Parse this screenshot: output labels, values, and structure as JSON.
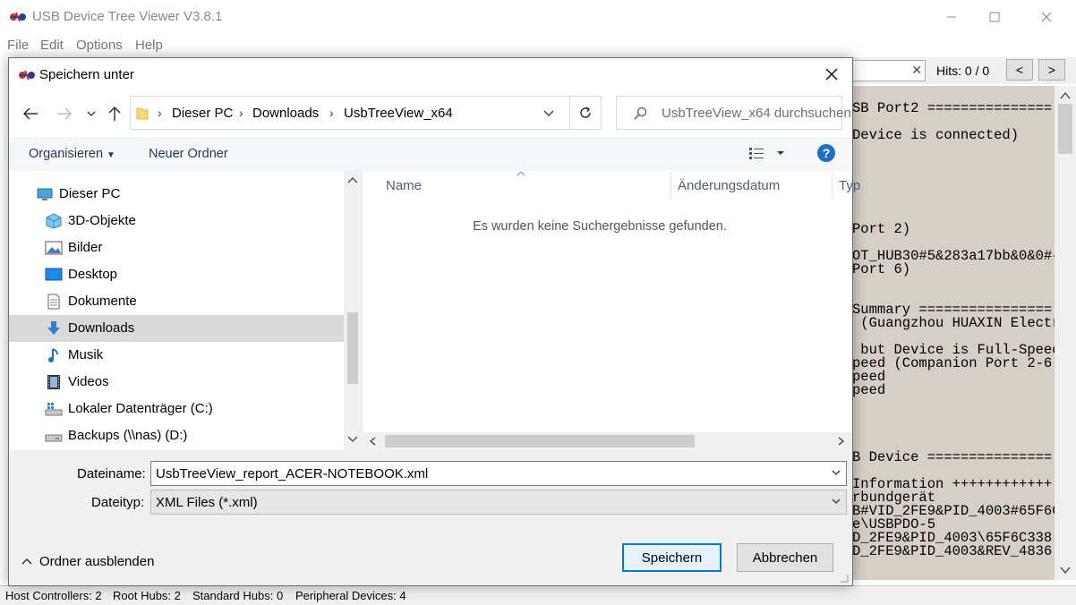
{
  "main_window": {
    "title": "USB Device Tree Viewer V3.8.1",
    "menu": [
      "File",
      "Edit",
      "Options",
      "Help"
    ],
    "hits_label": "Hits: 0 / 0",
    "hits_clear": "✕",
    "prev_btn": "<",
    "next_btn": ">",
    "text_lines": [
      "SB Port2 ===============",
      "Device is connected)",
      "Port 2)",
      "OT_HUB30#5&283a17bb&0&0#{",
      "Port 6)",
      "Summary ================",
      " (Guangzhou HUAXIN Electr",
      " but Device is Full-Speed",
      "peed (Companion Port 2-6",
      "peed",
      "peed",
      "B Device ===============",
      "Information ++++++++++++",
      "rbundgerät",
      "B#VID_2FE9&PID_4003#65F6C",
      "e\\USBPDO-5",
      "D_2FE9&PID_4003\\65F6C338",
      "D_2FE9&PID_4003&REV_4836"
    ],
    "status": {
      "host_controllers": "Host Controllers: 2",
      "root_hubs": "Root Hubs: 2",
      "standard_hubs": "Standard Hubs: 0",
      "peripheral_devices": "Peripheral Devices: 4"
    }
  },
  "dialog": {
    "title": "Speichern unter",
    "breadcrumb": [
      "Dieser PC",
      "Downloads",
      "UsbTreeView_x64"
    ],
    "search_placeholder": "UsbTreeView_x64 durchsuchen",
    "toolbar": {
      "organize": "Organisieren",
      "new_folder": "Neuer Ordner"
    },
    "tree": [
      {
        "label": "Dieser PC",
        "icon": "pc-icon",
        "indent": 0,
        "selected": false
      },
      {
        "label": "3D-Objekte",
        "icon": "3d-objects-icon",
        "indent": 1,
        "selected": false
      },
      {
        "label": "Bilder",
        "icon": "pictures-icon",
        "indent": 1,
        "selected": false
      },
      {
        "label": "Desktop",
        "icon": "desktop-icon",
        "indent": 1,
        "selected": false
      },
      {
        "label": "Dokumente",
        "icon": "documents-icon",
        "indent": 1,
        "selected": false
      },
      {
        "label": "Downloads",
        "icon": "downloads-icon",
        "indent": 1,
        "selected": true
      },
      {
        "label": "Musik",
        "icon": "music-icon",
        "indent": 1,
        "selected": false
      },
      {
        "label": "Videos",
        "icon": "videos-icon",
        "indent": 1,
        "selected": false
      },
      {
        "label": "Lokaler Datenträger (C:)",
        "icon": "local-disk-icon",
        "indent": 1,
        "selected": false
      },
      {
        "label": "Backups (\\\\nas) (D:)",
        "icon": "network-drive-icon",
        "indent": 1,
        "selected": false
      }
    ],
    "columns": {
      "name": "Name",
      "modified": "Änderungsdatum",
      "type": "Typ"
    },
    "empty_message": "Es wurden keine Suchergebnisse gefunden.",
    "filename_label": "Dateiname:",
    "filename_value": "UsbTreeView_report_ACER-NOTEBOOK.xml",
    "filetype_label": "Dateityp:",
    "filetype_value": "XML Files (*.xml)",
    "hide_folders": "Ordner ausblenden",
    "save_button": "Speichern",
    "cancel_button": "Abbrechen",
    "colors": {
      "accent": "#0078d7",
      "selected_row": "#d9d9d9",
      "text_pane_bg": "#d4d0c8"
    }
  }
}
